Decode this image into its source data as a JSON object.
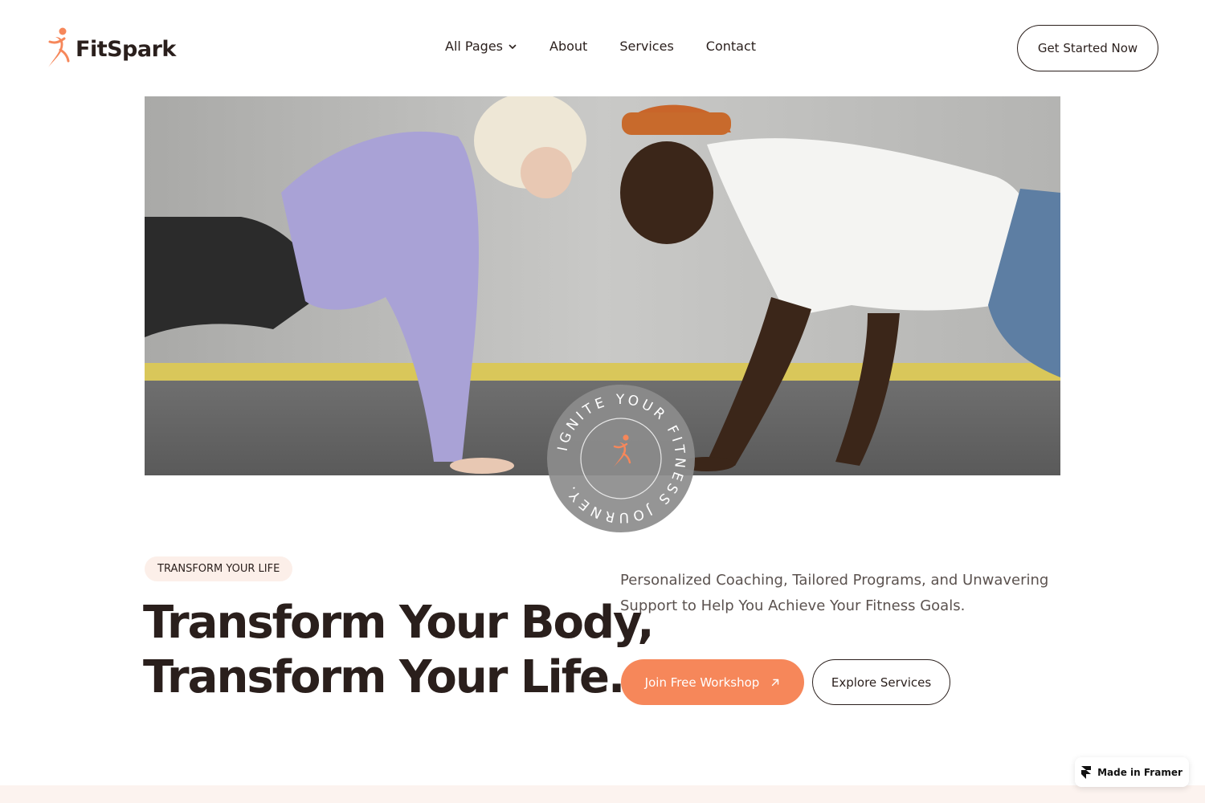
{
  "brand": {
    "name": "FitSpark",
    "accent": "#f6875a",
    "dark": "#2a1f1c",
    "tag_bg": "#fcefe9"
  },
  "nav": {
    "items": [
      {
        "label": "All Pages",
        "has_dropdown": true
      },
      {
        "label": "About"
      },
      {
        "label": "Services"
      },
      {
        "label": "Contact"
      }
    ]
  },
  "header": {
    "cta_label": "Get Started Now"
  },
  "badge": {
    "ring_text": "IGNITE YOUR FITNESS JOURNEY."
  },
  "hero": {
    "tag": "TRANSFORM YOUR LIFE",
    "headline_line1": "Transform Your Body,",
    "headline_line2": "Transform Your Life.",
    "subtext": "Personalized Coaching, Tailored Programs, and Unwavering Support to Help You Achieve Your Fitness Goals.",
    "primary_cta": "Join Free Workshop",
    "secondary_cta": "Explore Services"
  },
  "framer_badge": {
    "label": "Made in Framer"
  }
}
